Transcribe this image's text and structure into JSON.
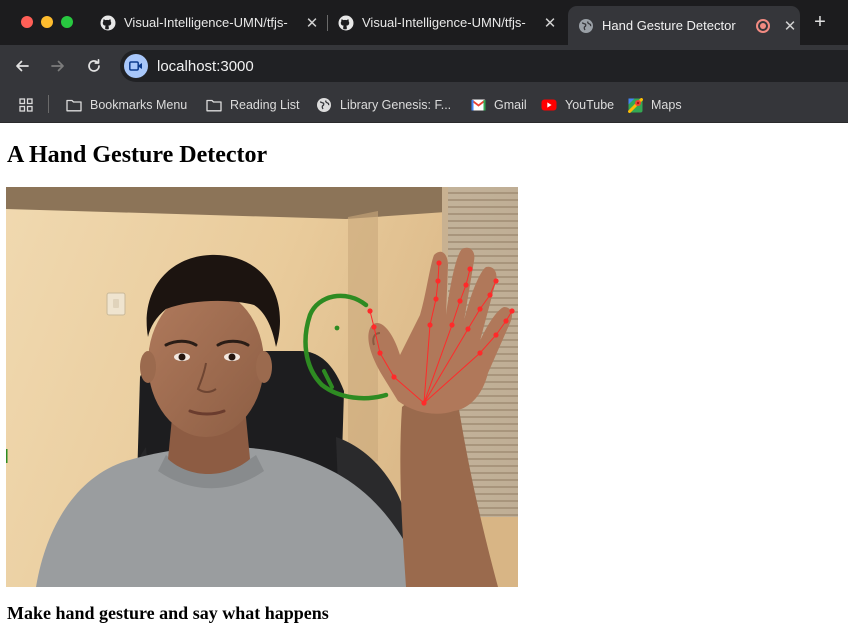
{
  "browser": {
    "tabs": [
      {
        "title": "Visual-Intelligence-UMN/tfjs-",
        "icon": "github-icon",
        "active": false
      },
      {
        "title": "Visual-Intelligence-UMN/tfjs-",
        "icon": "github-icon",
        "active": false
      },
      {
        "title": "Hand Gesture Detector",
        "icon": "globe-icon",
        "active": true
      }
    ],
    "address_bar": {
      "url": "localhost:3000"
    },
    "bookmarks": [
      {
        "label": "Bookmarks Menu",
        "icon": "folder-icon"
      },
      {
        "label": "Reading List",
        "icon": "folder-icon"
      },
      {
        "label": "Library Genesis: F...",
        "icon": "globe-icon"
      },
      {
        "label": "Gmail",
        "icon": "gmail-icon"
      },
      {
        "label": "YouTube",
        "icon": "youtube-icon"
      },
      {
        "label": "Maps",
        "icon": "maps-icon"
      }
    ]
  },
  "page": {
    "title": "A Hand Gesture Detector",
    "caption": "Make hand gesture and say what happens"
  },
  "colors": {
    "drawing_stroke": "#2e8b22",
    "landmark": "#ff2a2a",
    "active_tab": "#35363a"
  }
}
